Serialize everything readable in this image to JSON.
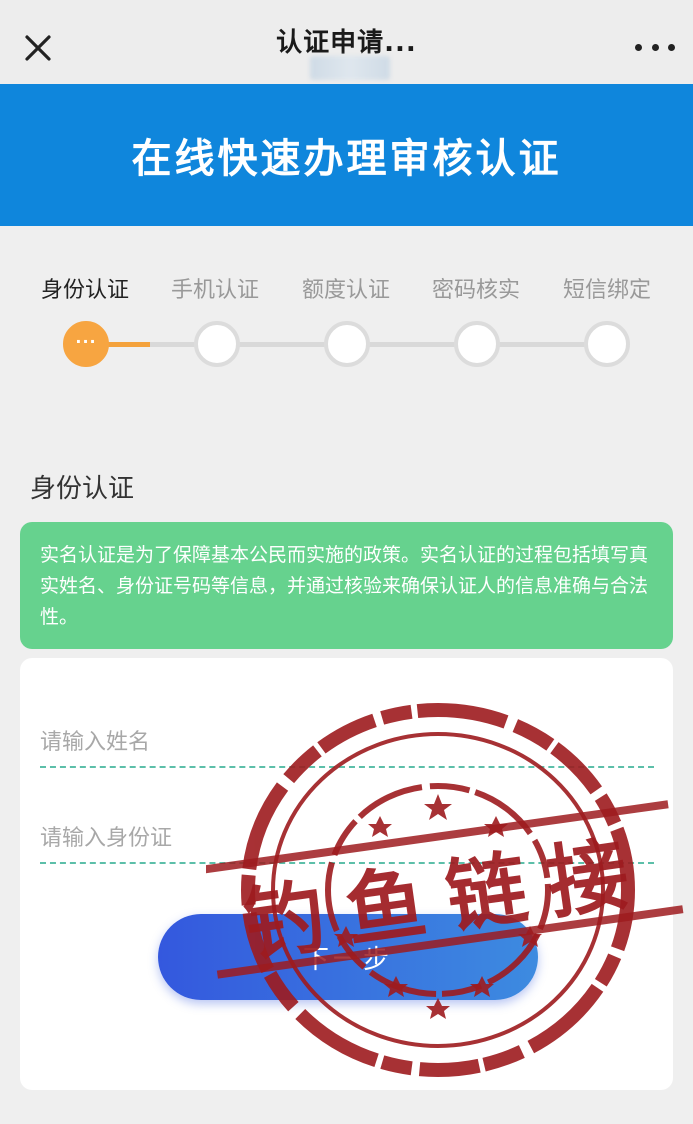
{
  "header": {
    "title": "认证申请...",
    "close_icon": "close-icon",
    "more_icon": "more-icon"
  },
  "banner": {
    "title": "在线快速办理审核认证",
    "background": "#0f86dc"
  },
  "steps": {
    "items": [
      {
        "label": "身份认证",
        "active": true
      },
      {
        "label": "手机认证",
        "active": false
      },
      {
        "label": "额度认证",
        "active": false
      },
      {
        "label": "密码核实",
        "active": false
      },
      {
        "label": "短信绑定",
        "active": false
      }
    ],
    "active_marker": "···",
    "active_color": "#f7a541"
  },
  "section": {
    "title": "身份认证"
  },
  "info": {
    "text": "实名认证是为了保障基本公民而实施的政策。实名认证的过程包括填写真实姓名、身份证号码等信息，并通过核验来确保认证人的信息准确与合法性。",
    "background": "#66d28e"
  },
  "form": {
    "name_placeholder": "请输入姓名",
    "name_value": "",
    "id_placeholder": "请输入身份证",
    "id_value": "",
    "next_label": "下一步"
  },
  "stamp": {
    "text": "钓鱼链接",
    "color": "#9e1b1f"
  }
}
